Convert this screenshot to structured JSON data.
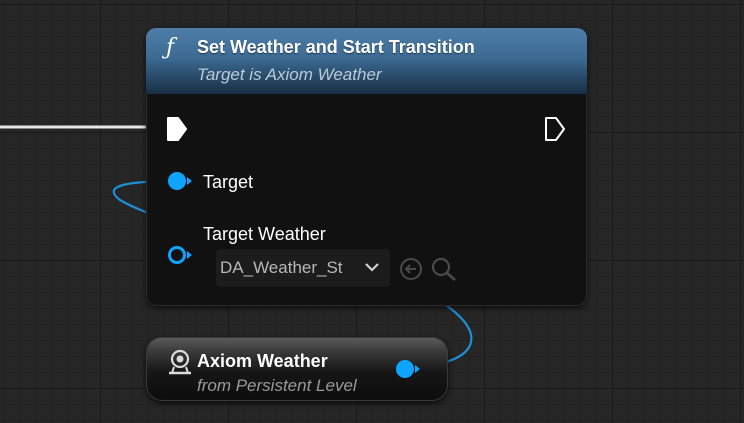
{
  "function_node": {
    "icon": "function-icon",
    "icon_glyph": "ƒ",
    "title": "Set Weather and Start Transition",
    "subtitle": "Target is Axiom Weather",
    "pins": {
      "target_label": "Target",
      "target_weather_label": "Target Weather",
      "target_weather_value": "DA_Weather_St"
    }
  },
  "variable_node": {
    "icon": "actor-icon",
    "title": "Axiom Weather",
    "subtitle": "from Persistent Level"
  },
  "colors": {
    "object_pin": "#0ea4ff",
    "exec_pin": "#ffffff",
    "header_blue": "#3c6a93",
    "wire_object": "#1c8fd6"
  }
}
